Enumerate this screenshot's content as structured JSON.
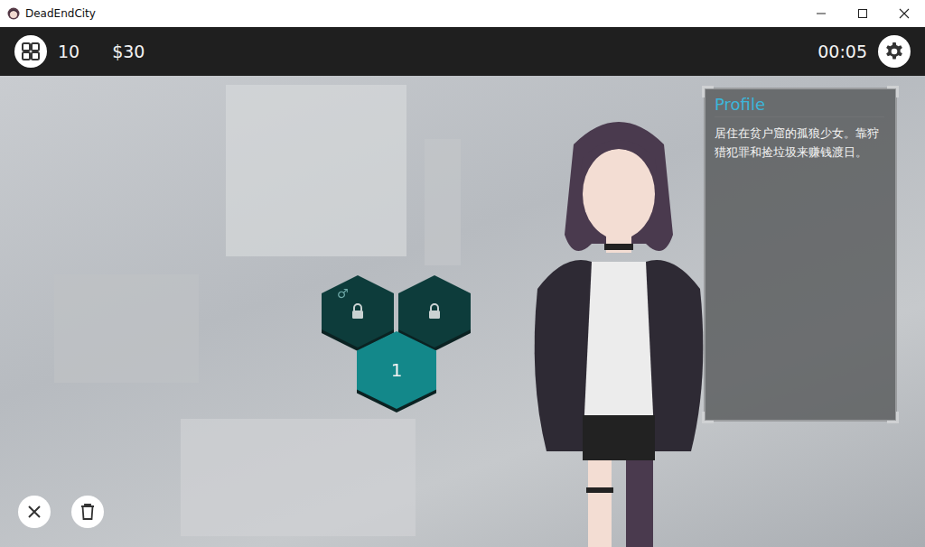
{
  "window": {
    "title": "DeadEndCity"
  },
  "top_bar": {
    "count": "10",
    "money": "$30",
    "time": "00:05"
  },
  "tiles": [
    {
      "label": "",
      "mark": "♂",
      "locked": true
    },
    {
      "label": "",
      "mark": "",
      "locked": true
    },
    {
      "label": "1",
      "mark": "",
      "locked": false
    }
  ],
  "profile": {
    "title": "Profile",
    "text": "居住在贫户窟的孤狼少女。靠狩猎犯罪和捡垃圾来赚钱渡日。"
  }
}
